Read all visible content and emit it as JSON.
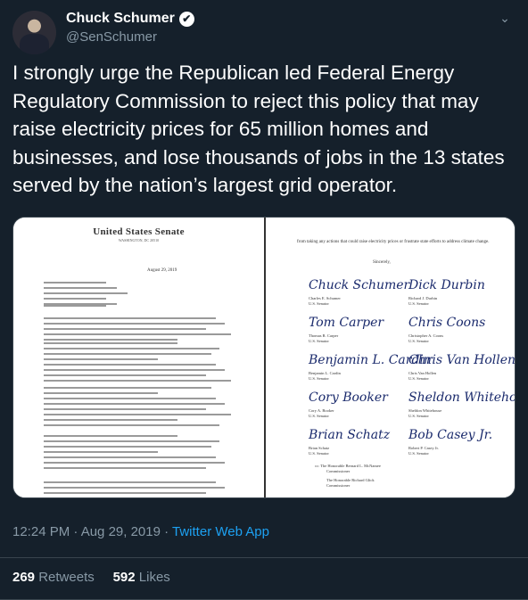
{
  "author": {
    "display_name": "Chuck Schumer",
    "handle": "@SenSchumer",
    "verified_icon": "✔"
  },
  "menu_icon": "⌄",
  "tweet": {
    "text": "I strongly urge the Republican led Federal Energy Regulatory Commission to reject this policy that may raise electricity prices for 65 million homes and businesses, and lose thousands of jobs in the 13 states served by the nation’s largest grid operator."
  },
  "letter": {
    "left": {
      "heading": "United States Senate",
      "subheading": "WASHINGTON, DC 20510",
      "date": "August 29, 2019"
    },
    "right": {
      "text": "from taking any actions that could raise electricity prices or frustrate state efforts to address climate change.",
      "closing": "Sincerely,",
      "signatures": [
        {
          "sig": "Chuck Schumer",
          "name": "Charles E. Schumer",
          "title": "U.S. Senator"
        },
        {
          "sig": "Dick Durbin",
          "name": "Richard J. Durbin",
          "title": "U.S. Senator"
        },
        {
          "sig": "Tom Carper",
          "name": "Thomas R. Carper",
          "title": "U.S. Senator"
        },
        {
          "sig": "Chris Coons",
          "name": "Christopher A. Coons",
          "title": "U.S. Senator"
        },
        {
          "sig": "Benjamin L. Cardin",
          "name": "Benjamin L. Cardin",
          "title": "U.S. Senator"
        },
        {
          "sig": "Chris Van Hollen",
          "name": "Chris Van Hollen",
          "title": "U.S. Senator"
        },
        {
          "sig": "Cory Booker",
          "name": "Cory A. Booker",
          "title": "U.S. Senator"
        },
        {
          "sig": "Sheldon Whitehouse",
          "name": "Sheldon Whitehouse",
          "title": "U.S. Senator"
        },
        {
          "sig": "Brian Schatz",
          "name": "Brian Schatz",
          "title": "U.S. Senator"
        },
        {
          "sig": "Bob Casey Jr.",
          "name": "Robert P. Casey Jr.",
          "title": "U.S. Senator"
        }
      ],
      "cc1": "cc: The Honorable Bernard L. McNamee",
      "cc1_title": "Commissioner",
      "cc2": "The Honorable Richard Glick",
      "cc2_title": "Commissioner"
    }
  },
  "meta": {
    "time": "12:24 PM · Aug 29, 2019 · ",
    "source": "Twitter Web App"
  },
  "stats": {
    "retweets_count": "269",
    "retweets_label": "Retweets",
    "likes_count": "592",
    "likes_label": "Likes"
  }
}
